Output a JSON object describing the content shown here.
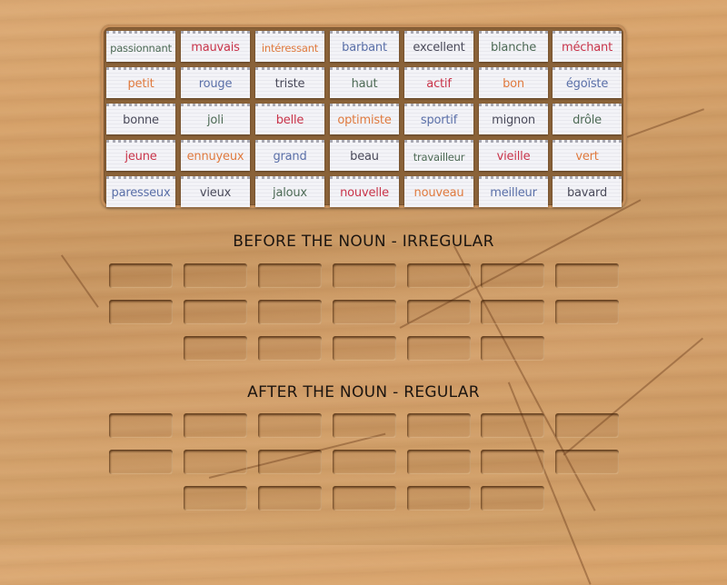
{
  "activity": {
    "type": "group-sort",
    "cards": [
      {
        "label": "passionnant",
        "color": "#4d6a55"
      },
      {
        "label": "mauvais",
        "color": "#c9344a"
      },
      {
        "label": "intéressant",
        "color": "#e07a3e"
      },
      {
        "label": "barbant",
        "color": "#5a6fa8"
      },
      {
        "label": "excellent",
        "color": "#4a4a5a"
      },
      {
        "label": "blanche",
        "color": "#4d6a55"
      },
      {
        "label": "méchant",
        "color": "#c9344a"
      },
      {
        "label": "petit",
        "color": "#e07a3e"
      },
      {
        "label": "rouge",
        "color": "#5a6fa8"
      },
      {
        "label": "triste",
        "color": "#4a4a5a"
      },
      {
        "label": "haut",
        "color": "#4d6a55"
      },
      {
        "label": "actif",
        "color": "#c9344a"
      },
      {
        "label": "bon",
        "color": "#e07a3e"
      },
      {
        "label": "égoïste",
        "color": "#5a6fa8"
      },
      {
        "label": "bonne",
        "color": "#4a4a5a"
      },
      {
        "label": "joli",
        "color": "#4d6a55"
      },
      {
        "label": "belle",
        "color": "#c9344a"
      },
      {
        "label": "optimiste",
        "color": "#e07a3e"
      },
      {
        "label": "sportif",
        "color": "#5a6fa8"
      },
      {
        "label": "mignon",
        "color": "#4a4a5a"
      },
      {
        "label": "drôle",
        "color": "#4d6a55"
      },
      {
        "label": "jeune",
        "color": "#c9344a"
      },
      {
        "label": "ennuyeux",
        "color": "#e07a3e"
      },
      {
        "label": "grand",
        "color": "#5a6fa8"
      },
      {
        "label": "beau",
        "color": "#4a4a5a"
      },
      {
        "label": "travailleur",
        "color": "#4d6a55"
      },
      {
        "label": "vieille",
        "color": "#c9344a"
      },
      {
        "label": "vert",
        "color": "#e07a3e"
      },
      {
        "label": "paresseux",
        "color": "#5a6fa8"
      },
      {
        "label": "vieux",
        "color": "#4a4a5a"
      },
      {
        "label": "jaloux",
        "color": "#4d6a55"
      },
      {
        "label": "nouvelle",
        "color": "#c9344a"
      },
      {
        "label": "nouveau",
        "color": "#e07a3e"
      },
      {
        "label": "meilleur",
        "color": "#5a6fa8"
      },
      {
        "label": "bavard",
        "color": "#4a4a5a"
      }
    ],
    "groups": [
      {
        "title": "BEFORE THE NOUN - IRREGULAR",
        "slot_count": 19
      },
      {
        "title": "AFTER THE NOUN - REGULAR",
        "slot_count": 19
      }
    ]
  },
  "colors": {
    "background": "#d4a068",
    "tray": "#7a5530",
    "heading": "#1c1510"
  }
}
